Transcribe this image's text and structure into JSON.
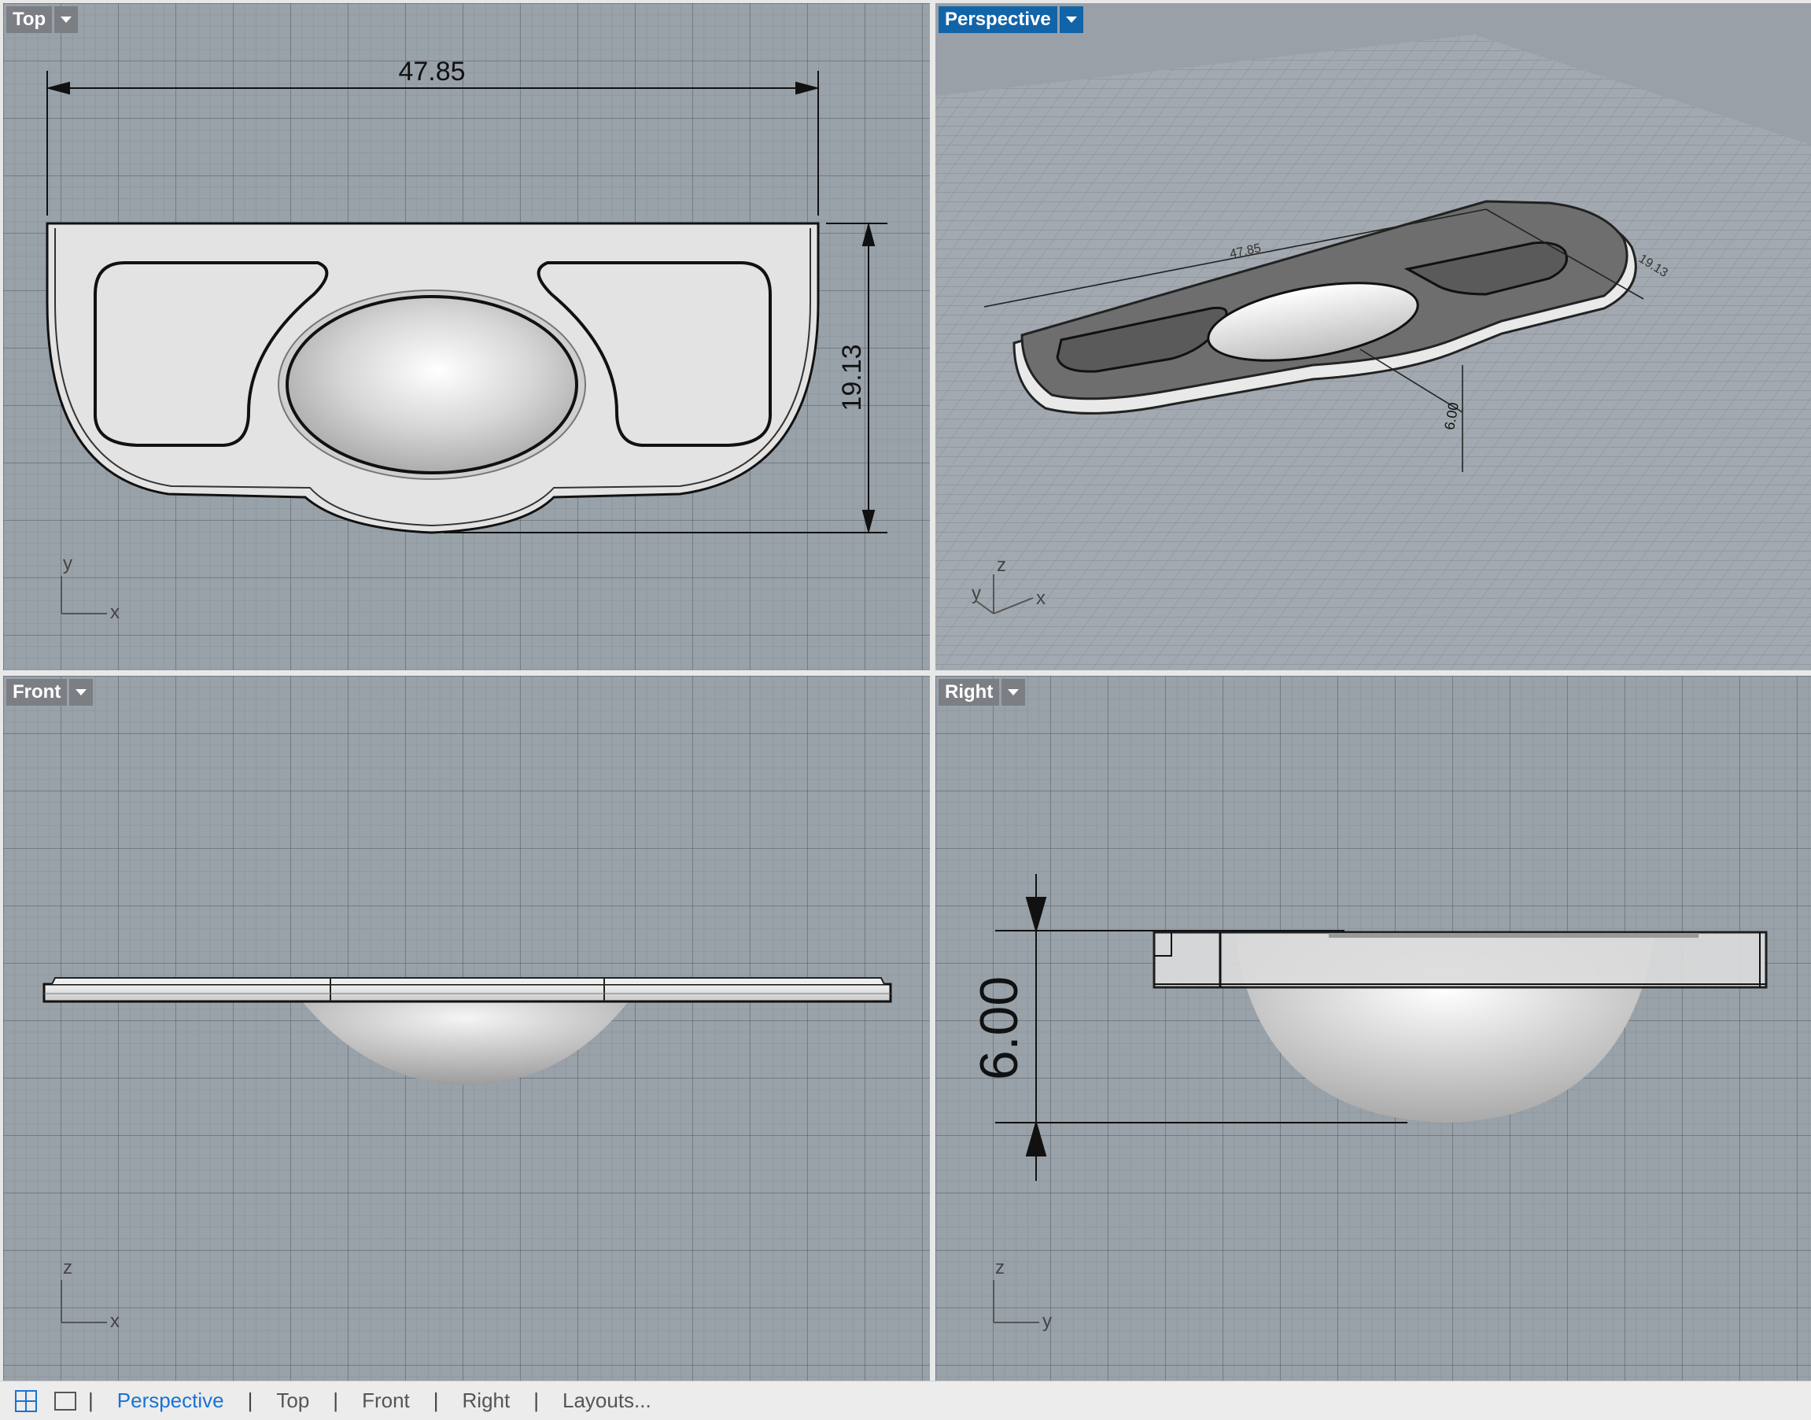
{
  "viewports": {
    "top": {
      "title": "Top",
      "dim_width": "47.85",
      "dim_height": "19.13",
      "axis_h": "x",
      "axis_v": "y"
    },
    "perspective": {
      "title": "Perspective",
      "dim_width": "47.85",
      "dim_height": "19.13",
      "dim_depth": "6.00",
      "axis_x": "x",
      "axis_y": "y",
      "axis_z": "z"
    },
    "front": {
      "title": "Front",
      "axis_h": "x",
      "axis_v": "z"
    },
    "right": {
      "title": "Right",
      "dim_depth": "6.00",
      "axis_h": "y",
      "axis_v": "z"
    }
  },
  "statusbar": {
    "tabs": [
      "Perspective",
      "Top",
      "Front",
      "Right",
      "Layouts..."
    ],
    "active_tab": "Perspective",
    "icons": [
      "four-viewports-icon",
      "single-viewport-icon"
    ]
  },
  "colors": {
    "active_title": "#1264a8",
    "inactive_title": "#7b7f84",
    "viewport_bg": "#99a1a9",
    "active_tab_text": "#1a73d1"
  }
}
